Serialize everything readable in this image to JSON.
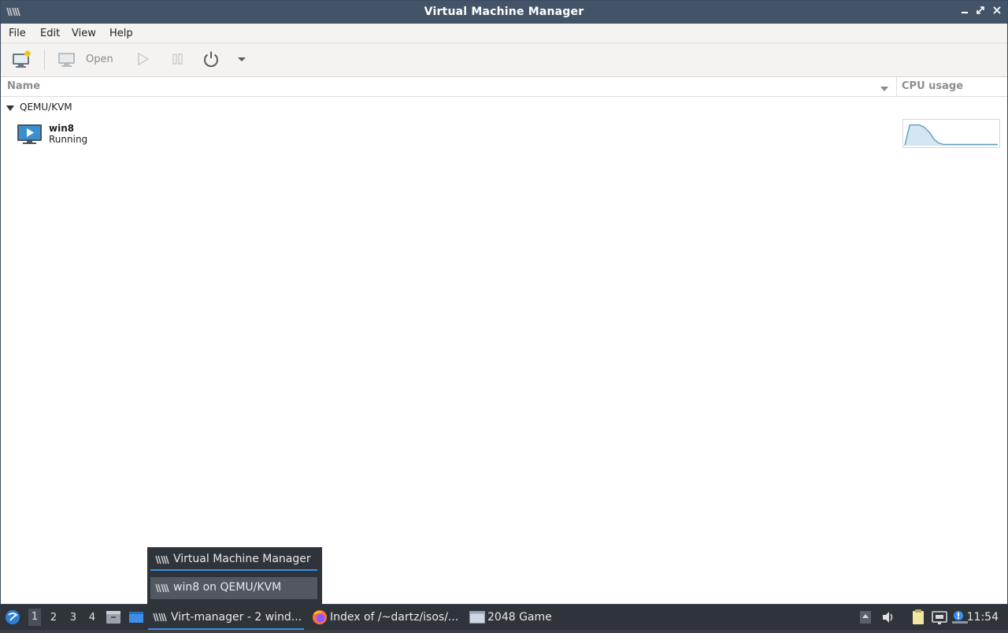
{
  "window": {
    "title": "Virtual Machine Manager",
    "controls": [
      "minimize",
      "restore",
      "close"
    ]
  },
  "menu": {
    "file": "File",
    "edit": "Edit",
    "view": "View",
    "help": "Help"
  },
  "toolbar": {
    "open_label": "Open"
  },
  "columns": {
    "name": "Name",
    "cpu": "CPU usage"
  },
  "group": {
    "name": "QEMU/KVM"
  },
  "vm": {
    "name": "win8",
    "status": "Running",
    "cpu_history": [
      0.02,
      0.85,
      0.85,
      0.85,
      0.75,
      0.55,
      0.25,
      0.1,
      0.05,
      0.05,
      0.05,
      0.05,
      0.05,
      0.05,
      0.05,
      0.05,
      0.05,
      0.05,
      0.05,
      0.05
    ]
  },
  "popup": {
    "items": [
      {
        "label": "Virtual Machine Manager"
      },
      {
        "label": "win8 on QEMU/KVM"
      }
    ]
  },
  "taskbar": {
    "workspaces": [
      "1",
      "2",
      "3",
      "4"
    ],
    "active_workspace": "1",
    "tasks": [
      {
        "label": "Virt-manager - 2 wind..."
      },
      {
        "label": "Index of /~dartz/isos/..."
      },
      {
        "label": "2048 Game"
      }
    ],
    "clock": "11:54"
  },
  "colors": {
    "titlebar": "#445468",
    "taskbar": "#2f343b",
    "accent": "#3d8ee6",
    "cpu_line": "#5aa0c4"
  }
}
